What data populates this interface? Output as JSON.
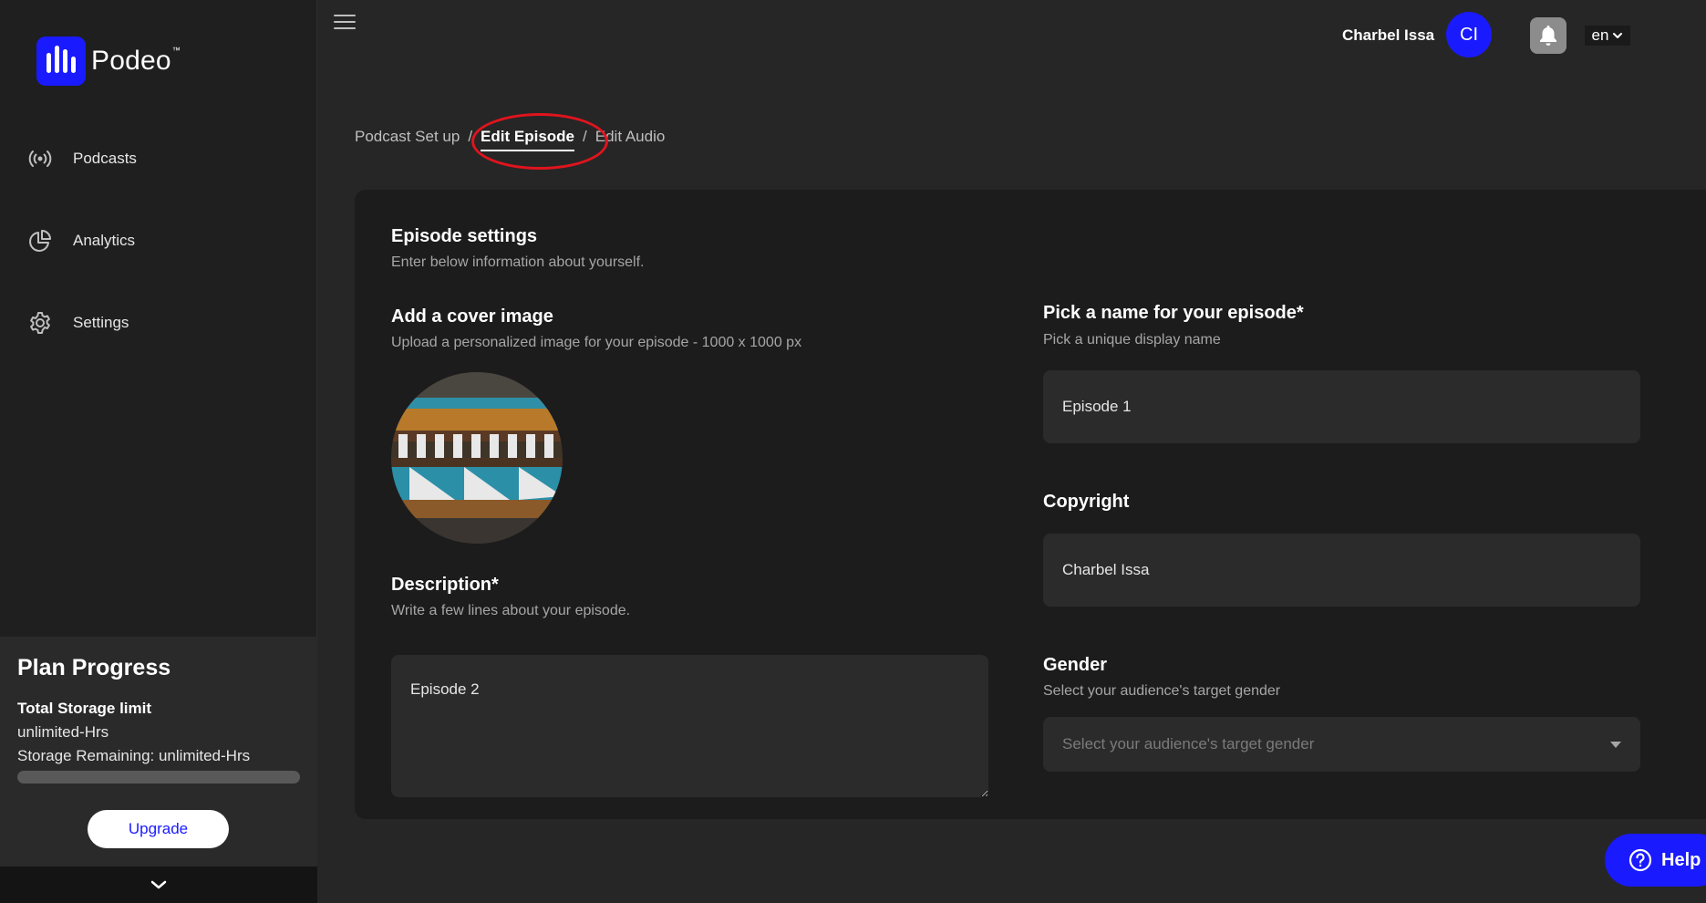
{
  "brand": {
    "name": "Podeo",
    "tm": "™"
  },
  "sidebar": {
    "items": [
      {
        "label": "Podcasts",
        "icon": "broadcast-icon"
      },
      {
        "label": "Analytics",
        "icon": "pie-chart-icon"
      },
      {
        "label": "Settings",
        "icon": "gear-icon"
      }
    ],
    "plan": {
      "title": "Plan Progress",
      "storage_title": "Total Storage limit",
      "storage_value": "unlimited-Hrs",
      "remaining": "Storage Remaining: unlimited-Hrs",
      "progress_fraction": 0,
      "upgrade_label": "Upgrade"
    }
  },
  "header": {
    "user_name": "Charbel Issa",
    "avatar_initials": "CI",
    "language": "en"
  },
  "breadcrumb": {
    "items": [
      "Podcast Set up",
      "Edit Episode",
      "Edit Audio"
    ],
    "active_index": 1
  },
  "form": {
    "title": "Episode settings",
    "subtitle": "Enter below information about yourself.",
    "cover": {
      "label": "Add a cover image",
      "hint": "Upload a personalized image for your episode - 1000 x 1000 px"
    },
    "description": {
      "label": "Description*",
      "hint": "Write a few lines about your episode.",
      "value": "Episode 2"
    },
    "name": {
      "label": "Pick a name for your episode*",
      "hint": "Pick a unique display name",
      "value": "Episode 1"
    },
    "copyright": {
      "label": "Copyright",
      "value": "Charbel Issa"
    },
    "gender": {
      "label": "Gender",
      "hint": "Select your audience's target gender",
      "placeholder": "Select your audience's target gender"
    }
  },
  "help": {
    "label": "Help"
  },
  "colors": {
    "accent": "#1a1aff",
    "highlight": "#e0141e"
  }
}
